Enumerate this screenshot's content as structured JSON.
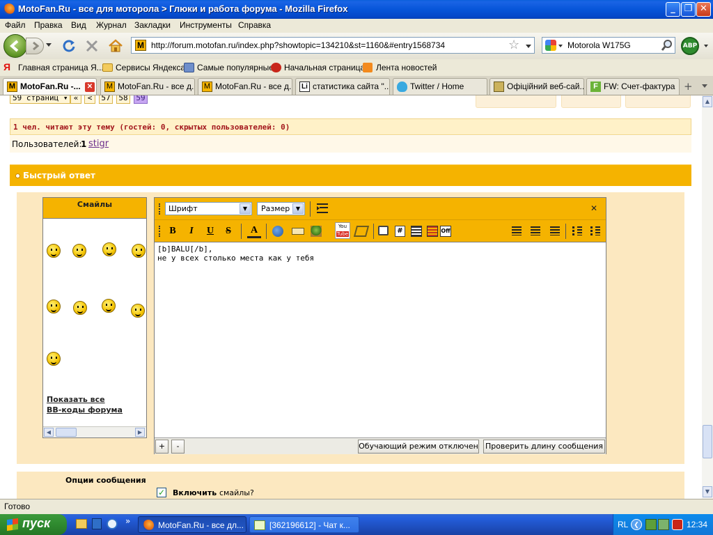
{
  "window": {
    "title": "MotoFan.Ru - все для моторола > Глюки и работа форума - Mozilla Firefox"
  },
  "menu": [
    "Файл",
    "Правка",
    "Вид",
    "Журнал",
    "Закладки",
    "Инструменты",
    "Справка"
  ],
  "nav": {
    "url": "http://forum.motofan.ru/index.php?showtopic=134210&st=1160&#entry1568734",
    "search_value": "Motorola W175G",
    "abp_label": "ABP"
  },
  "bookmarks": [
    "Главная страница Я...",
    "Сервисы Яндекса",
    "Самые популярные",
    "Начальная страница",
    "Лента новостей"
  ],
  "tabs": [
    "MotoFan.Ru -...",
    "MotoFan.Ru - все д...",
    "MotoFan.Ru - все д...",
    "статистика сайта \"...",
    "Twitter / Home",
    "Офіційний веб-сай...",
    "FW: Счет-фактура"
  ],
  "forum": {
    "pages": {
      "count_label": "59 страниц",
      "first": "«",
      "prev": "<",
      "p57": "57",
      "p58": "58",
      "p59": "59"
    },
    "reading": "1 чел. читают эту тему (гостей: 0, скрытых пользователей: 0)",
    "users_label": "Пользователей:",
    "users_count": "1",
    "user_name": "stigr",
    "quick_reply": "Быстрый ответ",
    "smilies_title": "Смайлы",
    "show_all": "Показать все",
    "bbcodes": "BB-коды форума",
    "font_select": "Шрифт",
    "size_select": "Размер",
    "editor_line1": "[b]BALU[/b],",
    "editor_line2": "не у всех столько места как у тебя",
    "plus": "+",
    "minus": "-",
    "training_btn": "Обучающий режим отключен",
    "check_length_btn": "Проверить длину сообщения",
    "options_title": "Опции сообщения",
    "enable_bold": "Включить",
    "enable_rest": "смайлы?"
  },
  "status": "Готово",
  "taskbar": {
    "start": "пуск",
    "tasks": [
      "MotoFan.Ru - все дл...",
      "[362196612] - Чат к..."
    ],
    "lang": "RL",
    "clock": "12:34"
  }
}
